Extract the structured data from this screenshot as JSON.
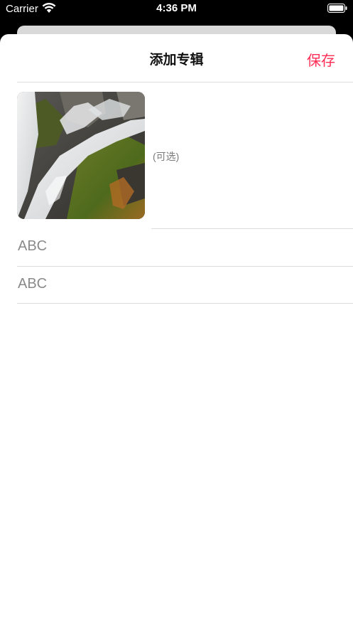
{
  "status_bar": {
    "carrier": "Carrier",
    "time": "4:36 PM",
    "icons": [
      "wifi-icon",
      "battery-icon"
    ]
  },
  "nav": {
    "title": "添加专辑",
    "save_label": "保存",
    "accent_color": "#ff2d55"
  },
  "cover": {
    "image": "waterfall-photo",
    "hint": "(可选)"
  },
  "fields": [
    {
      "value": "ABC"
    },
    {
      "value": "ABC"
    }
  ]
}
